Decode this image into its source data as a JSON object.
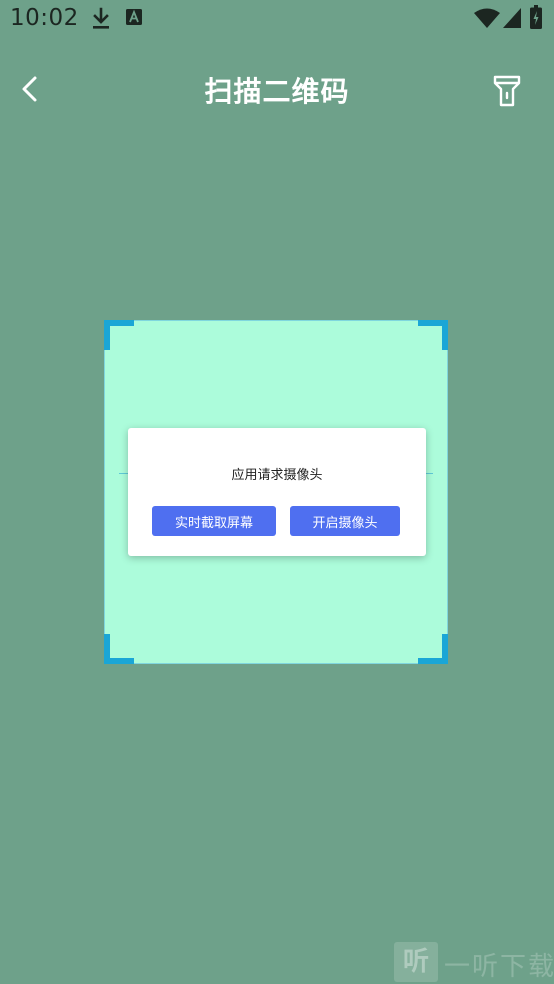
{
  "status_bar": {
    "time": "10:02",
    "icons": [
      "download-icon",
      "a-badge-icon",
      "wifi-icon",
      "signal-icon",
      "battery-charging-icon"
    ]
  },
  "header": {
    "title": "扫描二维码",
    "back_icon": "chevron-left-icon",
    "flashlight_icon": "flashlight-icon"
  },
  "dialog": {
    "message": "应用请求摄像头",
    "buttons": {
      "screen_capture": "实时截取屏幕",
      "open_camera": "开启摄像头"
    }
  },
  "watermark": {
    "badge": "听",
    "text": "一听下载"
  },
  "colors": {
    "background": "#6ea18a",
    "scan_area": "#acfcdb",
    "corner_accent": "#1aa6d6",
    "button": "#4f6ff0"
  }
}
